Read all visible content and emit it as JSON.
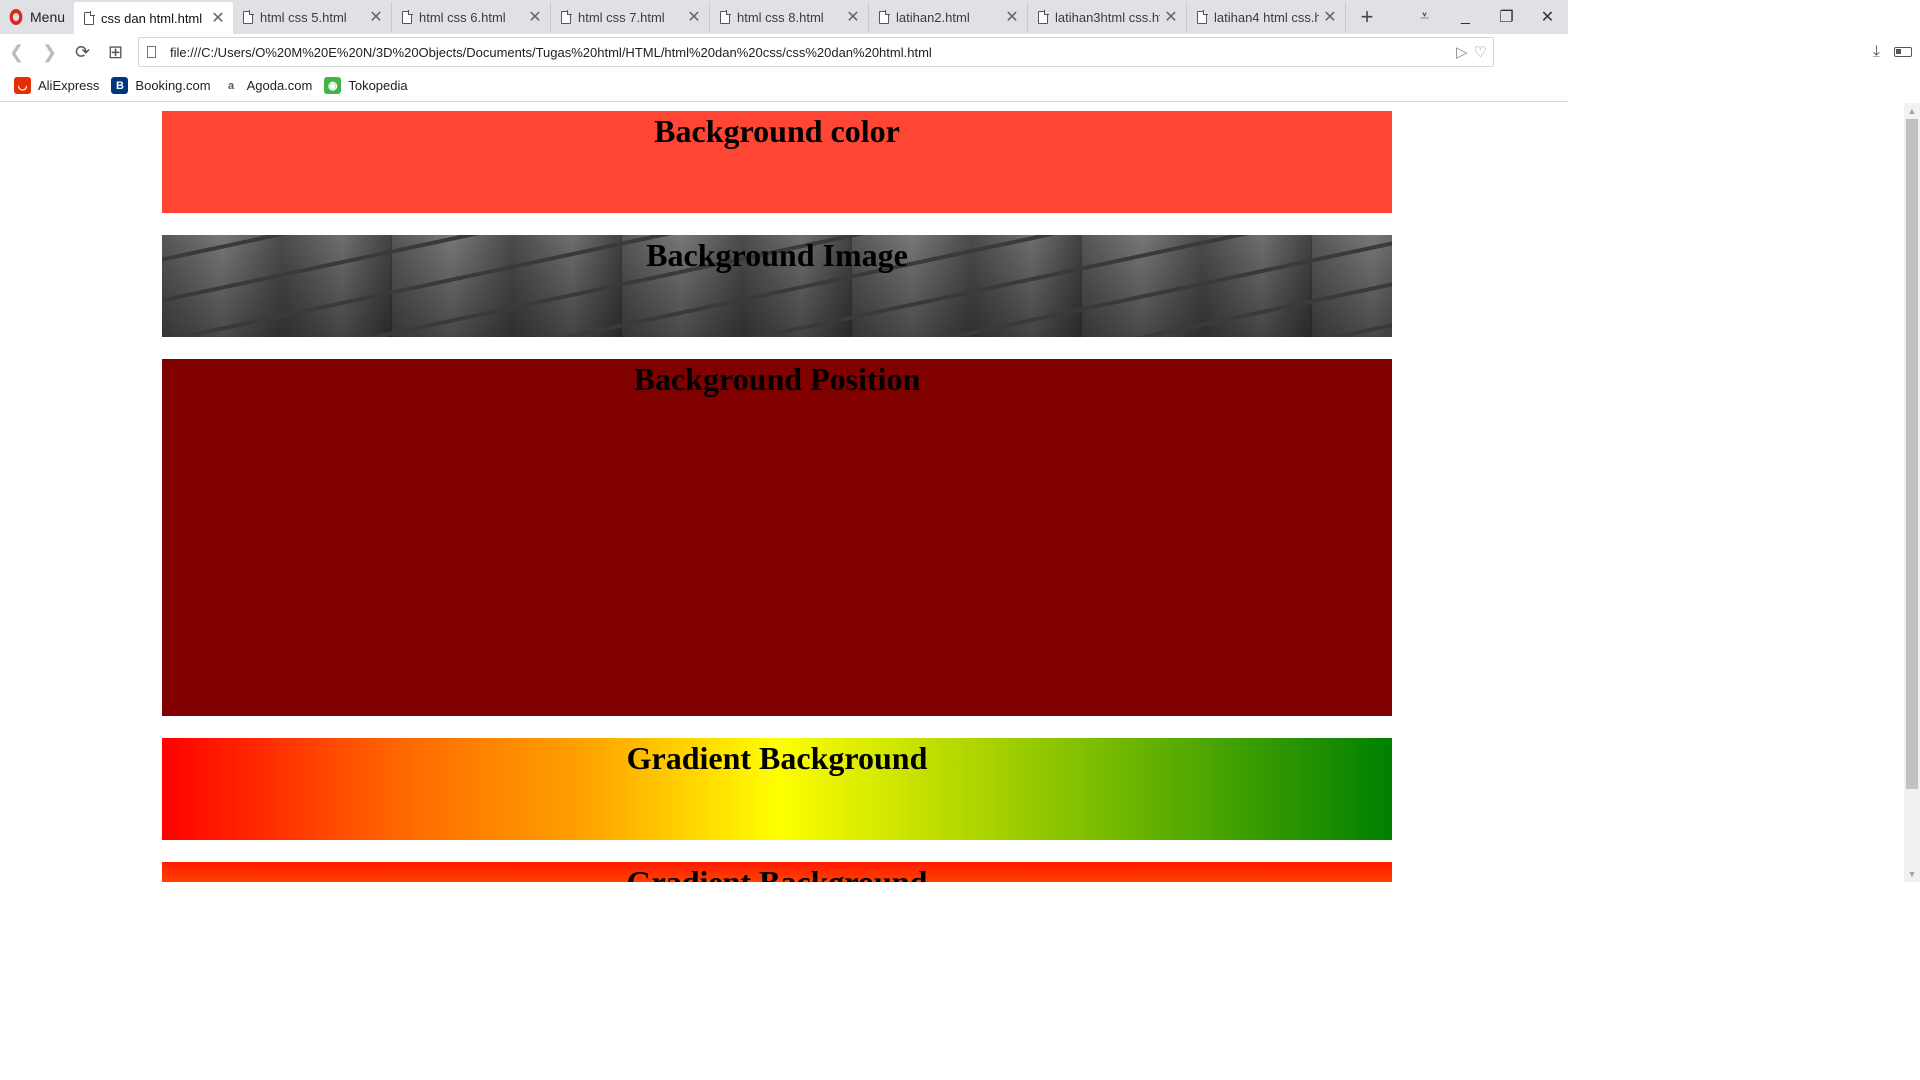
{
  "browser": {
    "menu_label": "Menu",
    "tabs": [
      {
        "title": "css dan html.html",
        "active": true
      },
      {
        "title": "html css 5.html",
        "active": false
      },
      {
        "title": "html css 6.html",
        "active": false
      },
      {
        "title": "html css 7.html",
        "active": false
      },
      {
        "title": "html css 8.html",
        "active": false
      },
      {
        "title": "latihan2.html",
        "active": false
      },
      {
        "title": "latihan3html css.ht",
        "active": false
      },
      {
        "title": "latihan4 html css.ht",
        "active": false
      }
    ],
    "url": "file:///C:/Users/O%20M%20E%20N/3D%20Objects/Documents/Tugas%20html/HTML/html%20dan%20css/css%20dan%20html.html",
    "bookmarks": [
      {
        "label": "AliExpress",
        "icon": "aliexpress-icon",
        "color": "#e62e04"
      },
      {
        "label": "Booking.com",
        "icon": "booking-icon",
        "color": "#003580"
      },
      {
        "label": "Agoda.com",
        "icon": "agoda-icon",
        "color": "#5c5c5c"
      },
      {
        "label": "Tokopedia",
        "icon": "tokopedia-icon",
        "color": "#42b549"
      }
    ]
  },
  "page": {
    "sections": [
      {
        "heading": "Background color",
        "background": "#ff4533"
      },
      {
        "heading": "Background Image",
        "background": "stone-wall-texture"
      },
      {
        "heading": "Background Position",
        "background": "#800000"
      },
      {
        "heading": "Gradient Background",
        "background": "red-orange-yellow-green horizontal gradient"
      },
      {
        "heading": "Gradient Background",
        "background": "red-orange vertical gradient"
      }
    ]
  }
}
